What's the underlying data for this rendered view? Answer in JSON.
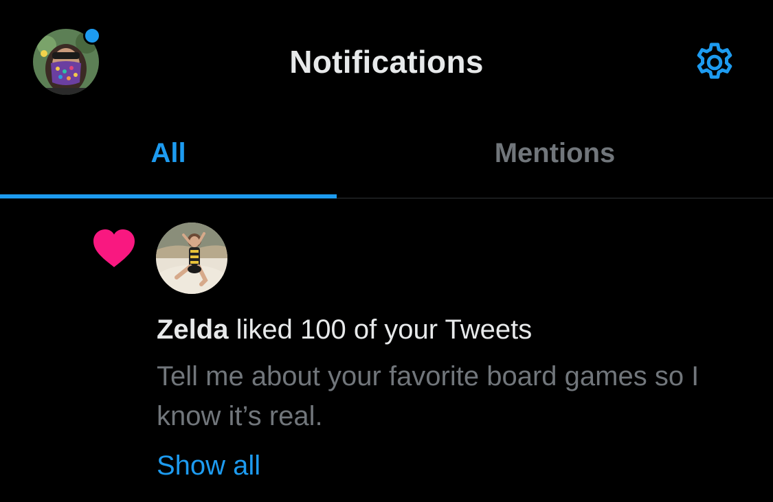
{
  "header": {
    "title": "Notifications",
    "avatar_icon": "user-avatar",
    "settings_icon": "gear-icon",
    "unread_dot_color": "#1d9bf0"
  },
  "tabs": [
    {
      "label": "All",
      "active": true
    },
    {
      "label": "Mentions",
      "active": false
    }
  ],
  "notification": {
    "type_icon": "heart-icon",
    "icon_color": "#f91880",
    "user_name": "Zelda",
    "action_text": " liked 100 of your Tweets",
    "tweet_text": "Tell me about your favorite board games so I know it’s real.",
    "show_all_label": "Show all"
  },
  "colors": {
    "background": "#000000",
    "accent": "#1d9bf0",
    "primary_text": "#e7e9ea",
    "secondary_text": "#71767b",
    "divider": "#2f3336"
  }
}
